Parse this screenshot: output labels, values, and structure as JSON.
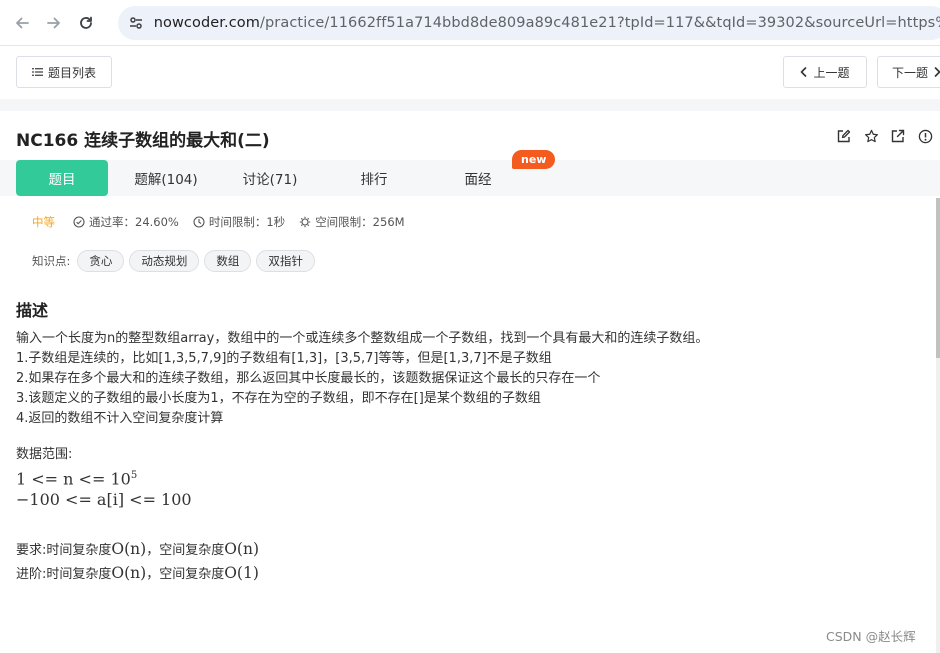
{
  "browser": {
    "url_host": "nowcoder.com",
    "url_path": "/practice/11662ff51a714bbd8de809a89c481e21?tpId=117&&tqId=39302&sourceUrl=https%3A%2F%"
  },
  "toolbar": {
    "list_label": "题目列表",
    "prev_label": "上一题",
    "next_label": "下一题"
  },
  "problem": {
    "title": "NC166  连续子数组的最大和(二)",
    "difficulty": "中等",
    "pass_rate": "通过率：24.60%",
    "time_limit": "时间限制：1秒",
    "space_limit": "空间限制：256M",
    "tags_label": "知识点:",
    "tags": [
      "贪心",
      "动态规划",
      "数组",
      "双指针"
    ]
  },
  "tabs": {
    "problem": "题目",
    "solutions": "题解(104)",
    "discuss": "讨论(71)",
    "rank": "排行",
    "interview": "面经",
    "new_badge": "new"
  },
  "description": {
    "heading": "描述",
    "lines": [
      "输入一个长度为n的整型数组array，数组中的一个或连续多个整数组成一个子数组，找到一个具有最大和的连续子数组。",
      "1.子数组是连续的，比如[1,3,5,7,9]的子数组有[1,3]，[3,5,7]等等，但是[1,3,7]不是子数组",
      "2.如果存在多个最大和的连续子数组，那么返回其中长度最长的，该题数据保证这个最长的只存在一个",
      "3.该题定义的子数组的最小长度为1，不存在为空的子数组，即不存在[]是某个数组的子数组",
      "4.返回的数组不计入空间复杂度计算"
    ],
    "range_label": "数据范围:",
    "range_1": "1 <= n <= 10",
    "range_1_exp": "5",
    "range_2": "−100 <= a[i] <= 100",
    "req_prefix": "要求:时间复杂度",
    "req_time": "O(n)",
    "req_mid": "，空间复杂度",
    "req_space": "O(n)",
    "adv_prefix": "进阶:时间复杂度",
    "adv_time": "O(n)",
    "adv_mid": "，空间复杂度",
    "adv_space": "O(1)"
  },
  "watermark": "CSDN @赵长辉",
  "colors": {
    "accent": "#32ca99",
    "badge": "#f35b1f",
    "difficulty": "#f5a623"
  }
}
